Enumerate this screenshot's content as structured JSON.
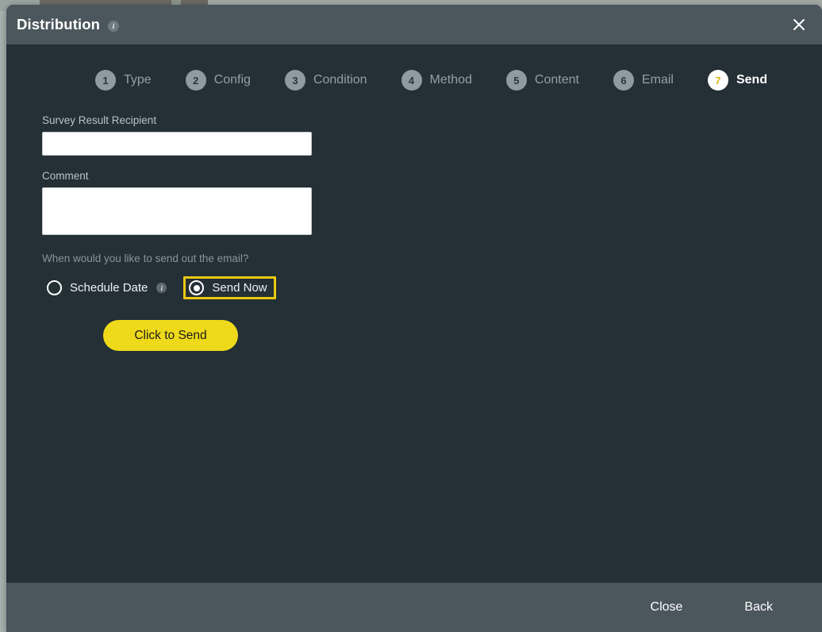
{
  "window": {
    "title": "Distribution",
    "title_info_icon": "info-icon",
    "close_icon": "close-icon"
  },
  "steps": [
    {
      "number": "1",
      "label": "Type",
      "active": false
    },
    {
      "number": "2",
      "label": "Config",
      "active": false
    },
    {
      "number": "3",
      "label": "Condition",
      "active": false
    },
    {
      "number": "4",
      "label": "Method",
      "active": false
    },
    {
      "number": "5",
      "label": "Content",
      "active": false
    },
    {
      "number": "6",
      "label": "Email",
      "active": false
    },
    {
      "number": "7",
      "label": "Send",
      "active": true
    }
  ],
  "form": {
    "recipient": {
      "label": "Survey Result Recipient",
      "value": "",
      "placeholder": ""
    },
    "comment": {
      "label": "Comment",
      "value": "",
      "placeholder": ""
    },
    "send_question": "When would you like to send out the email?",
    "radio_options": [
      {
        "label": "Schedule Date",
        "selected": false,
        "info_icon": "info-icon"
      },
      {
        "label": "Send Now",
        "selected": true,
        "highlighted": true
      }
    ],
    "send_button_label": "Click to Send"
  },
  "footer": {
    "close_label": "Close",
    "back_label": "Back"
  },
  "colors": {
    "header": "#4b565d",
    "body": "#242f36",
    "accent_yellow": "#eed91a",
    "focus_outline": "#e8c90f",
    "step_inactive": "#8e9ba0",
    "text_muted": "#93a0a6"
  }
}
